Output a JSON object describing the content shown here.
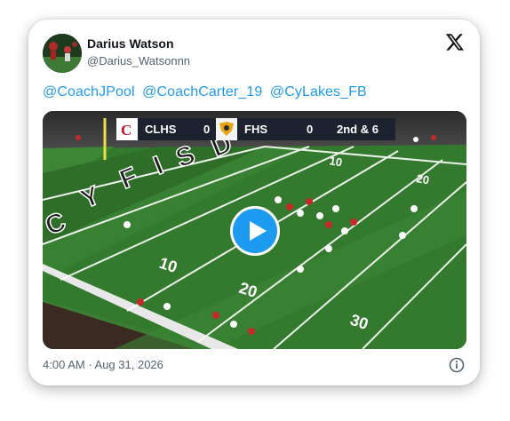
{
  "tweet": {
    "author_name": "Darius Watson",
    "author_handle": "@Darius_Watsonnn",
    "mentions": [
      "@CoachJPool",
      "@CoachCarter_19",
      "@CyLakes_FB"
    ],
    "timestamp": "4:00 AM · Aug 31, 2026"
  },
  "video": {
    "scoreboard": {
      "team1": "CLHS",
      "score1": "0",
      "team2": "FHS",
      "score2": "0",
      "down": "2nd & 6"
    },
    "field_numbers": [
      "10",
      "20",
      "30",
      "10",
      "20"
    ],
    "end_zone_text": "C Y F I S D"
  },
  "icons": {
    "brand": "x-logo-icon",
    "play": "play-icon",
    "info": "info-icon"
  },
  "colors": {
    "link": "#1d9bf0",
    "play_button": "#1d9bf0",
    "field": "#2f6b2a"
  }
}
